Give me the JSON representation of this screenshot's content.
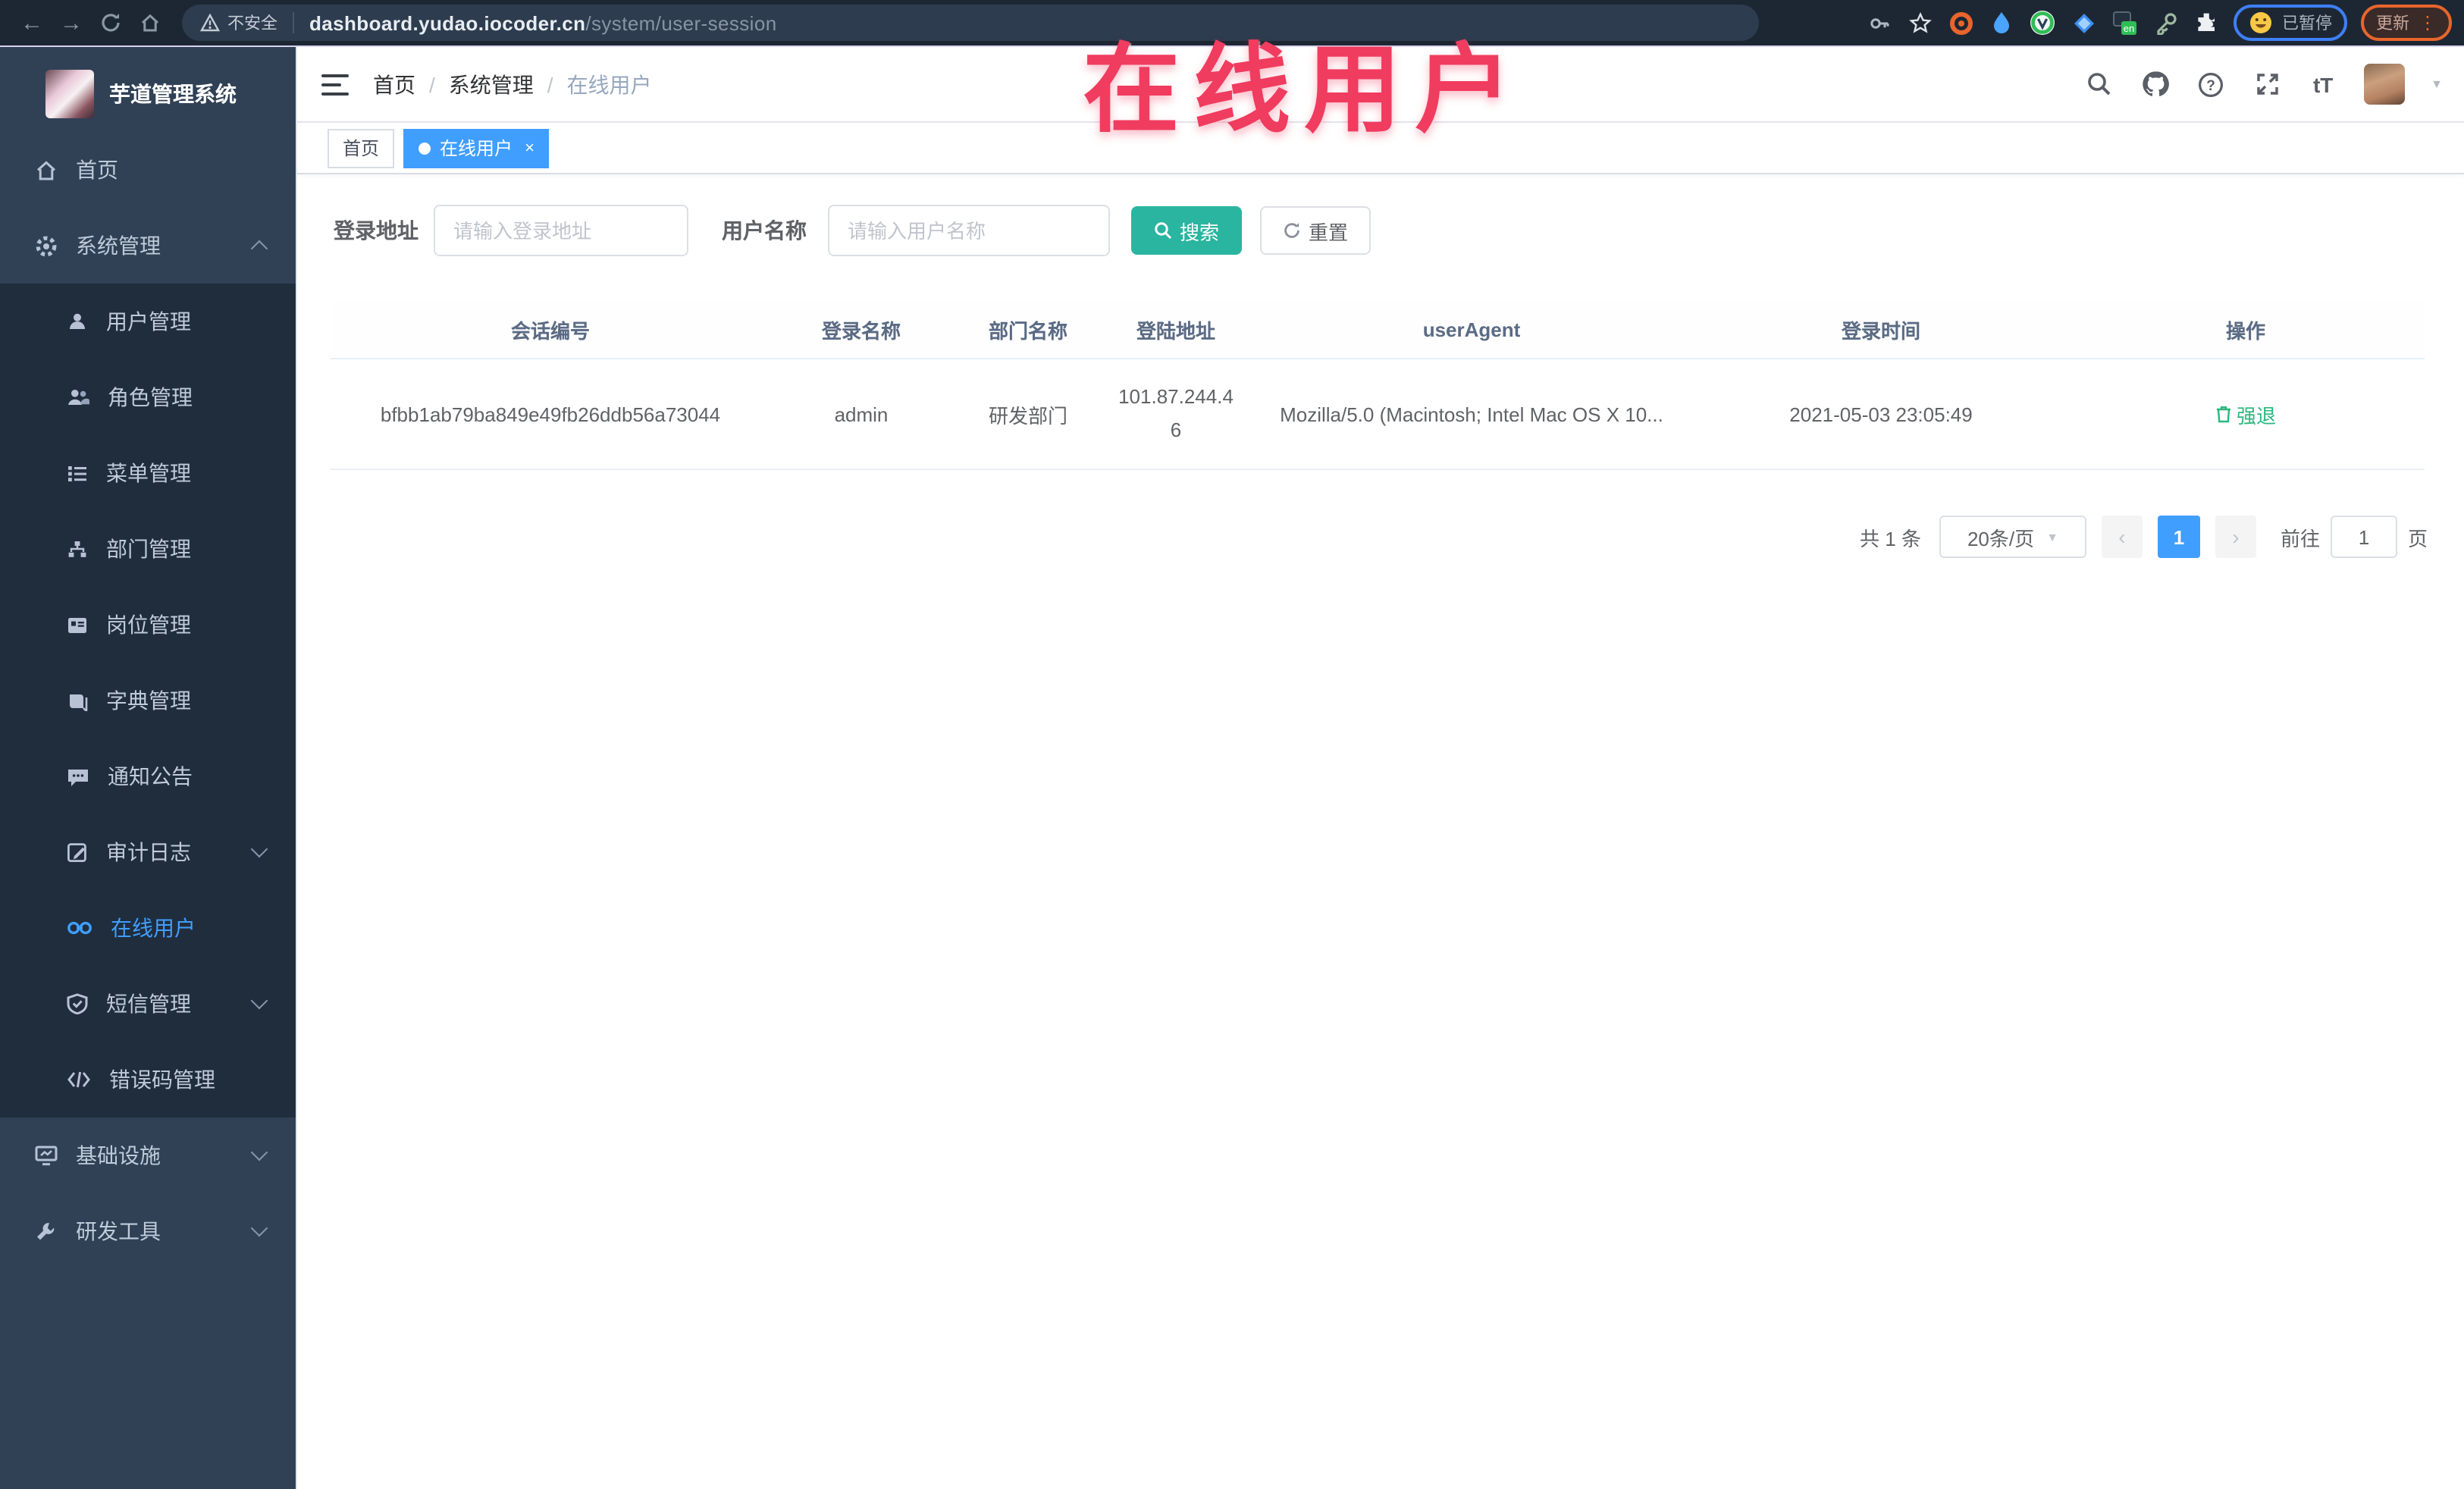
{
  "colors": {
    "accent": "#409eff",
    "search_button": "#2ab5a0",
    "action_green": "#2ab77d",
    "annotation_pink": "#f03c5f",
    "sidebar_bg": "#304156",
    "submenu_bg": "#1f2d3d",
    "chrome_bg": "#1d2733"
  },
  "browser": {
    "not_secure_label": "不安全",
    "url_domain": "dashboard.yudao.iocoder.cn",
    "url_path": "/system/user-session",
    "en_badge": "en",
    "paused_badge": "已暂停",
    "update_button": "更新",
    "kebab": "⋮"
  },
  "overlay": {
    "title": "在线用户"
  },
  "sidebar": {
    "title": "芋道管理系统",
    "items": [
      {
        "label": "首页",
        "icon": "home-icon",
        "level": "top"
      },
      {
        "label": "系统管理",
        "icon": "gear-icon",
        "level": "top",
        "arrow": "up"
      },
      {
        "label": "用户管理",
        "icon": "user-icon",
        "level": "sub"
      },
      {
        "label": "角色管理",
        "icon": "users-icon",
        "level": "sub"
      },
      {
        "label": "菜单管理",
        "icon": "menu-list-icon",
        "level": "sub"
      },
      {
        "label": "部门管理",
        "icon": "org-tree-icon",
        "level": "sub"
      },
      {
        "label": "岗位管理",
        "icon": "id-card-icon",
        "level": "sub"
      },
      {
        "label": "字典管理",
        "icon": "book-icon",
        "level": "sub"
      },
      {
        "label": "通知公告",
        "icon": "megaphone-icon",
        "level": "sub"
      },
      {
        "label": "审计日志",
        "icon": "edit-log-icon",
        "level": "sub",
        "arrow": "down"
      },
      {
        "label": "在线用户",
        "icon": "link-icon",
        "level": "sub",
        "active": true
      },
      {
        "label": "短信管理",
        "icon": "message-shield-icon",
        "level": "sub",
        "arrow": "down"
      },
      {
        "label": "错误码管理",
        "icon": "code-icon",
        "level": "sub"
      },
      {
        "label": "基础设施",
        "icon": "monitor-icon",
        "level": "top",
        "arrow": "down"
      },
      {
        "label": "研发工具",
        "icon": "wrench-icon",
        "level": "top",
        "arrow": "down"
      }
    ]
  },
  "header": {
    "breadcrumb": [
      "首页",
      "系统管理",
      "在线用户"
    ],
    "separator": "/",
    "font_size_toggle": "tT"
  },
  "tabs": [
    {
      "label": "首页",
      "active": false
    },
    {
      "label": "在线用户",
      "active": true,
      "close": "×"
    }
  ],
  "search": {
    "addr_label": "登录地址",
    "addr_placeholder": "请输入登录地址",
    "name_label": "用户名称",
    "name_placeholder": "请输入用户名称",
    "search_label": "搜索",
    "reset_label": "重置"
  },
  "table": {
    "headers": [
      "会话编号",
      "登录名称",
      "部门名称",
      "登陆地址",
      "userAgent",
      "登录时间",
      "操作"
    ],
    "row": {
      "session_id": "bfbb1ab79ba849e49fb26ddb56a73044",
      "login_name": "admin",
      "dept_name": "研发部门",
      "login_addr": "101.87.244.46",
      "user_agent": "Mozilla/5.0 (Macintosh; Intel Mac OS X 10...",
      "login_time": "2021-05-03 23:05:49",
      "action": "强退"
    }
  },
  "pagination": {
    "total": "共 1 条",
    "per_page": "20条/页",
    "prev": "‹",
    "page": "1",
    "next": "›",
    "goto_label": "前往",
    "goto_value": "1",
    "page_unit": "页"
  }
}
